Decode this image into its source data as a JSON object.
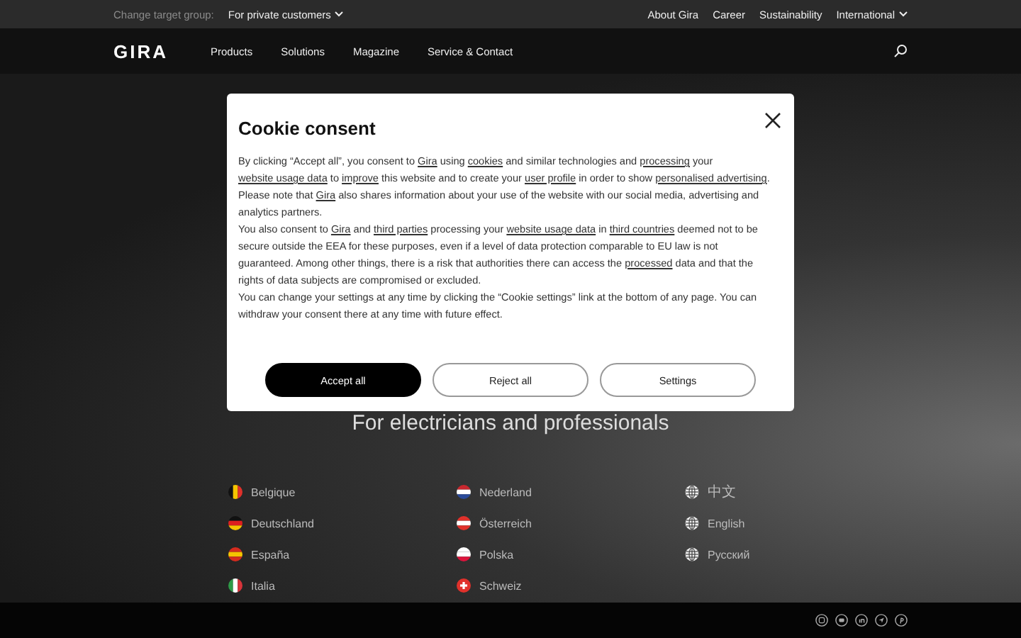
{
  "top_bar": {
    "target_label": "Change target group:",
    "target_value": "For private customers",
    "links": [
      "About Gira",
      "Career",
      "Sustainability",
      "International"
    ]
  },
  "nav": {
    "logo": "GIRA",
    "items": [
      "Products",
      "Solutions",
      "Magazine",
      "Service & Contact"
    ]
  },
  "hero": {
    "subtitle": "For electricians and professionals"
  },
  "countries": [
    {
      "label": "Belgique",
      "kind": "flag-vertical",
      "stripes": [
        {
          "color": "#111111"
        },
        {
          "color": "#f5c400"
        },
        {
          "color": "#e0312b"
        }
      ]
    },
    {
      "label": "Nederland",
      "kind": "flag-horizontal",
      "stripes": [
        {
          "color": "#c8272e"
        },
        {
          "color": "#ffffff"
        },
        {
          "color": "#2a4a9a"
        }
      ]
    },
    {
      "label": "中文",
      "kind": "globe"
    },
    {
      "label": "Deutschland",
      "kind": "flag-horizontal",
      "stripes": [
        {
          "color": "#111111"
        },
        {
          "color": "#dd1f1f"
        },
        {
          "color": "#f5c400"
        }
      ]
    },
    {
      "label": "Österreich",
      "kind": "flag-horizontal",
      "stripes": [
        {
          "color": "#e0312b"
        },
        {
          "color": "#ffffff"
        },
        {
          "color": "#e0312b"
        }
      ]
    },
    {
      "label": "English",
      "kind": "globe"
    },
    {
      "label": "España",
      "kind": "flag-horizontal",
      "stripes": [
        {
          "color": "#d52b1e"
        },
        {
          "color": "#f5c400"
        },
        {
          "color": "#d52b1e"
        }
      ]
    },
    {
      "label": "Polska",
      "kind": "flag-horizontal",
      "stripes": [
        {
          "color": "#ffffff"
        },
        {
          "color": "#ffffff"
        },
        {
          "color": "#dc143c"
        }
      ]
    },
    {
      "label": "Русский",
      "kind": "globe"
    },
    {
      "label": "Italia",
      "kind": "flag-vertical",
      "stripes": [
        {
          "color": "#2e9a47"
        },
        {
          "color": "#ffffff"
        },
        {
          "color": "#d8343a"
        }
      ]
    },
    {
      "label": "Schweiz",
      "kind": "flag-cross",
      "stripes": [
        {
          "color": "#e0312b"
        },
        {
          "color": "#ffffff"
        }
      ]
    }
  ],
  "dialog": {
    "title": "Cookie consent",
    "paragraphs": [
      [
        {
          "text": "By clicking “Accept all”, you consent to "
        },
        {
          "text": "Gira",
          "link": true
        },
        {
          "text": " using "
        },
        {
          "text": "cookies",
          "link": true
        },
        {
          "text": " and similar technologies and "
        },
        {
          "text": "processing",
          "link": true
        },
        {
          "text": " your "
        },
        {
          "text": "website usage data",
          "link": true
        },
        {
          "text": " to "
        },
        {
          "text": "improve",
          "link": true
        },
        {
          "text": " this website and to create your "
        },
        {
          "text": "user profile",
          "link": true
        },
        {
          "text": " in order to show "
        },
        {
          "text": "personalised advertising",
          "link": true
        },
        {
          "text": ". Please note that "
        },
        {
          "text": "Gira",
          "link": true
        },
        {
          "text": " also shares information about your use of the website with our social media, advertising and analytics partners."
        }
      ],
      [
        {
          "text": "You also consent to "
        },
        {
          "text": "Gira",
          "link": true
        },
        {
          "text": " and "
        },
        {
          "text": "third parties",
          "link": true
        },
        {
          "text": " processing your "
        },
        {
          "text": "website usage data",
          "link": true
        },
        {
          "text": " in "
        },
        {
          "text": "third countries",
          "link": true
        },
        {
          "text": " deemed not to be secure outside the EEA for these purposes, even if a level of data protection comparable to EU law is not guaranteed. Among other things, there is a risk that authorities there can access the "
        },
        {
          "text": "processed",
          "link": true
        },
        {
          "text": " data and that the rights of data subjects are compromised or excluded."
        }
      ],
      [
        {
          "text": "You can change your settings at any time by clicking the “Cookie settings” link at the bottom of any page. You can withdraw your consent there at any time with future effect."
        }
      ]
    ],
    "buttons": [
      {
        "label": "Accept all",
        "kind": "primary"
      },
      {
        "label": "Reject all",
        "kind": "outline"
      },
      {
        "label": "Settings",
        "kind": "outline"
      }
    ]
  }
}
